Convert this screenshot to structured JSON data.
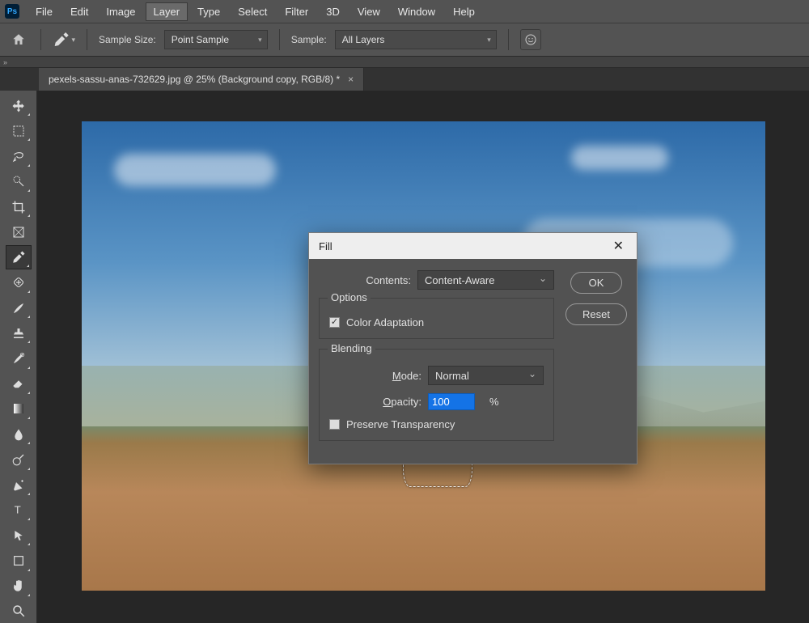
{
  "app": {
    "logo_text": "Ps"
  },
  "menu": [
    "File",
    "Edit",
    "Image",
    "Layer",
    "Type",
    "Select",
    "Filter",
    "3D",
    "View",
    "Window",
    "Help"
  ],
  "menu_active_index": 3,
  "options_bar": {
    "sample_size_label": "Sample Size:",
    "sample_size_value": "Point Sample",
    "sample_label": "Sample:",
    "sample_value": "All Layers"
  },
  "document": {
    "tab_title": "pexels-sassu-anas-732629.jpg @ 25% (Background copy, RGB/8) *"
  },
  "tools": [
    {
      "name": "move-tool",
      "arrow": true
    },
    {
      "name": "marquee-tool",
      "arrow": true
    },
    {
      "name": "lasso-tool",
      "arrow": true
    },
    {
      "name": "quick-select-tool",
      "arrow": true
    },
    {
      "name": "crop-tool",
      "arrow": true
    },
    {
      "name": "frame-tool",
      "arrow": false
    },
    {
      "name": "eyedropper-tool",
      "arrow": true,
      "active": true
    },
    {
      "name": "healing-tool",
      "arrow": true
    },
    {
      "name": "brush-tool",
      "arrow": true
    },
    {
      "name": "stamp-tool",
      "arrow": true
    },
    {
      "name": "history-brush-tool",
      "arrow": true
    },
    {
      "name": "eraser-tool",
      "arrow": true
    },
    {
      "name": "gradient-tool",
      "arrow": true
    },
    {
      "name": "blur-tool",
      "arrow": true
    },
    {
      "name": "dodge-tool",
      "arrow": true
    },
    {
      "name": "pen-tool",
      "arrow": true
    },
    {
      "name": "type-tool",
      "arrow": true
    },
    {
      "name": "path-select-tool",
      "arrow": true
    },
    {
      "name": "shape-tool",
      "arrow": true
    },
    {
      "name": "hand-tool",
      "arrow": true
    },
    {
      "name": "zoom-tool",
      "arrow": false
    }
  ],
  "dialog": {
    "title": "Fill",
    "contents_label": "Contents:",
    "contents_value": "Content-Aware",
    "options_legend": "Options",
    "color_adaptation_label": "Color Adaptation",
    "color_adaptation_checked": true,
    "blending_legend": "Blending",
    "mode_label": "Mode:",
    "mode_value": "Normal",
    "opacity_label": "Opacity:",
    "opacity_value": "100",
    "opacity_unit": "%",
    "preserve_label": "Preserve Transparency",
    "preserve_checked": false,
    "ok_label": "OK",
    "reset_label": "Reset"
  }
}
